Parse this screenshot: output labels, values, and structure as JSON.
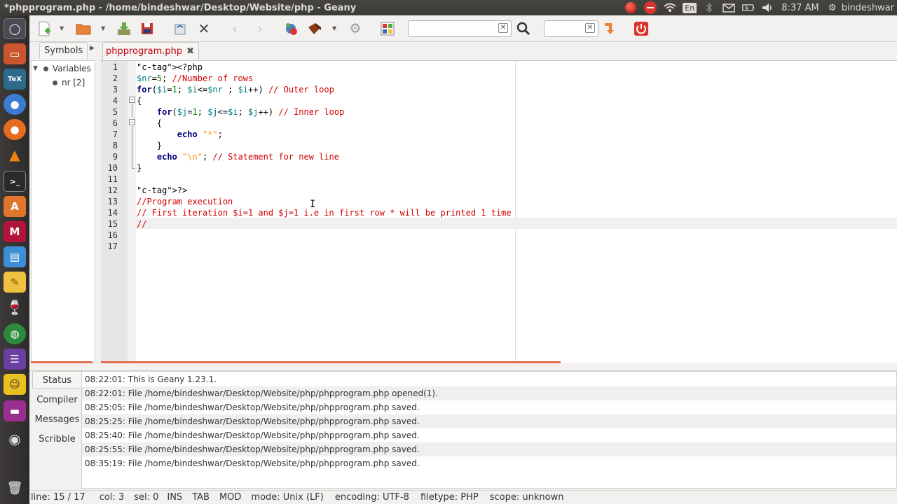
{
  "window": {
    "title": "*phpprogram.php - /home/bindeshwar/Desktop/Website/php - Geany"
  },
  "top_panel": {
    "keyboard_layout": "En",
    "clock": "8:37 AM",
    "user": "bindeshwar",
    "icons": [
      "record-icon",
      "stop-icon",
      "wifi-icon",
      "keyboard-icon",
      "bluetooth-icon",
      "mail-icon",
      "battery-icon",
      "volume-icon",
      "gear-icon"
    ]
  },
  "launcher": {
    "items": [
      "dash",
      "files",
      "tex",
      "chromium",
      "firefox",
      "vlc",
      "terminal",
      "software-center",
      "mendeley",
      "text-editor",
      "notes",
      "wine",
      "browser-globe",
      "settings",
      "user-avatar",
      "purple-app",
      "dvd",
      "trash"
    ]
  },
  "toolbar": {
    "items": [
      "new",
      "open",
      "save",
      "save-all",
      "revert",
      "close",
      "back",
      "forward",
      "compile",
      "build",
      "settings",
      "color-chooser"
    ],
    "search_value": "",
    "goto_value": ""
  },
  "sidebar": {
    "tab_label": "Symbols",
    "tree": [
      {
        "label": "Variables",
        "level": 0
      },
      {
        "label": "nr [2]",
        "level": 1
      }
    ]
  },
  "editor": {
    "tab_label": "phpprogram.php",
    "current_line": 15,
    "lines": [
      "<?php",
      "$nr=5; //Number of rows",
      "for($i=1; $i<=$nr ; $i++) // Outer loop",
      "{",
      "    for($j=1; $j<=$i; $j++) // Inner loop",
      "    {",
      "        echo \"*\";",
      "    }",
      "    echo \"\\n\"; // Statement for new line",
      "}",
      "",
      "?>",
      "//Program execution",
      "// First iteration $i=1 and $j=1 i.e in first row * will be printed 1 time",
      "//",
      "",
      ""
    ]
  },
  "messages": {
    "tabs": [
      "Status",
      "Compiler",
      "Messages",
      "Scribble"
    ],
    "active_tab": "Status",
    "rows": [
      "08:22:01: This is Geany 1.23.1.",
      "08:22:01: File /home/bindeshwar/Desktop/Website/php/phpprogram.php opened(1).",
      "08:25:05: File /home/bindeshwar/Desktop/Website/php/phpprogram.php saved.",
      "08:25:25: File /home/bindeshwar/Desktop/Website/php/phpprogram.php saved.",
      "08:25:40: File /home/bindeshwar/Desktop/Website/php/phpprogram.php saved.",
      "08:25:55: File /home/bindeshwar/Desktop/Website/php/phpprogram.php saved.",
      "08:35:19: File /home/bindeshwar/Desktop/Website/php/phpprogram.php saved."
    ]
  },
  "statusbar": {
    "line": "line: 15 / 17",
    "col": "col: 3",
    "sel": "sel: 0",
    "ins": "INS",
    "tab": "TAB",
    "mod": "MOD",
    "mode": "mode: Unix (LF)",
    "encoding": "encoding: UTF-8",
    "filetype": "filetype: PHP",
    "scope": "scope: unknown"
  },
  "colors": {
    "accent": "#e07050",
    "tab_label": "#c3000b",
    "keyword": "#00007f",
    "variable": "#007f7f",
    "comment": "#d00000",
    "string": "#ff901e"
  }
}
